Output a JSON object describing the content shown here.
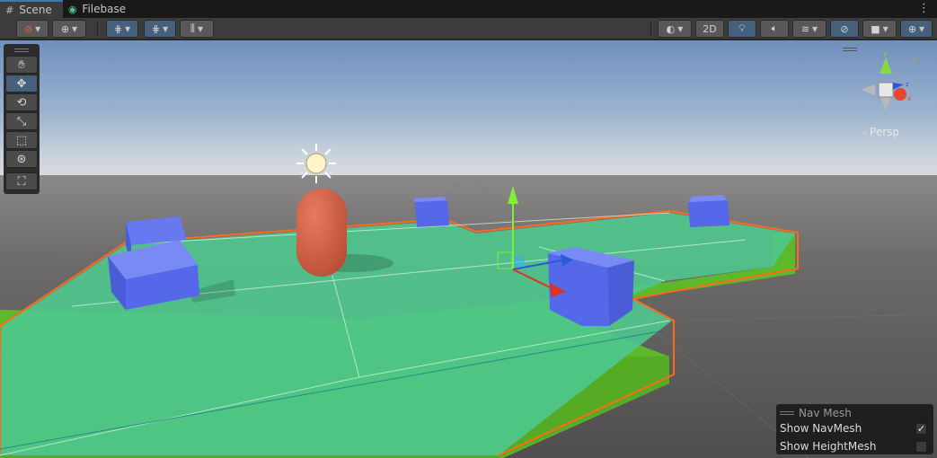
{
  "tabs": [
    {
      "label": "Scene",
      "icon": "grid-icon",
      "active": true
    },
    {
      "label": "Filebase",
      "icon": "eye-icon",
      "active": false
    }
  ],
  "toolbar": {
    "mode_2d": "2D"
  },
  "tools": [
    "hand",
    "move",
    "rotate",
    "scale",
    "rect",
    "transform",
    "custom"
  ],
  "gizmo": {
    "projection": "Persp",
    "axis_y": "y",
    "axis_z": "z",
    "axis_x": "x"
  },
  "navmesh_overlay": {
    "title": "Nav Mesh",
    "items": [
      {
        "label": "Show NavMesh",
        "checked": true
      },
      {
        "label": "Show HeightMesh",
        "checked": false
      }
    ]
  },
  "colors": {
    "accent": "#3a79bb",
    "navmesh": "#4fc88e",
    "ground": "#5db82a",
    "cube": "#5568ea",
    "capsule": "#d8684e"
  }
}
